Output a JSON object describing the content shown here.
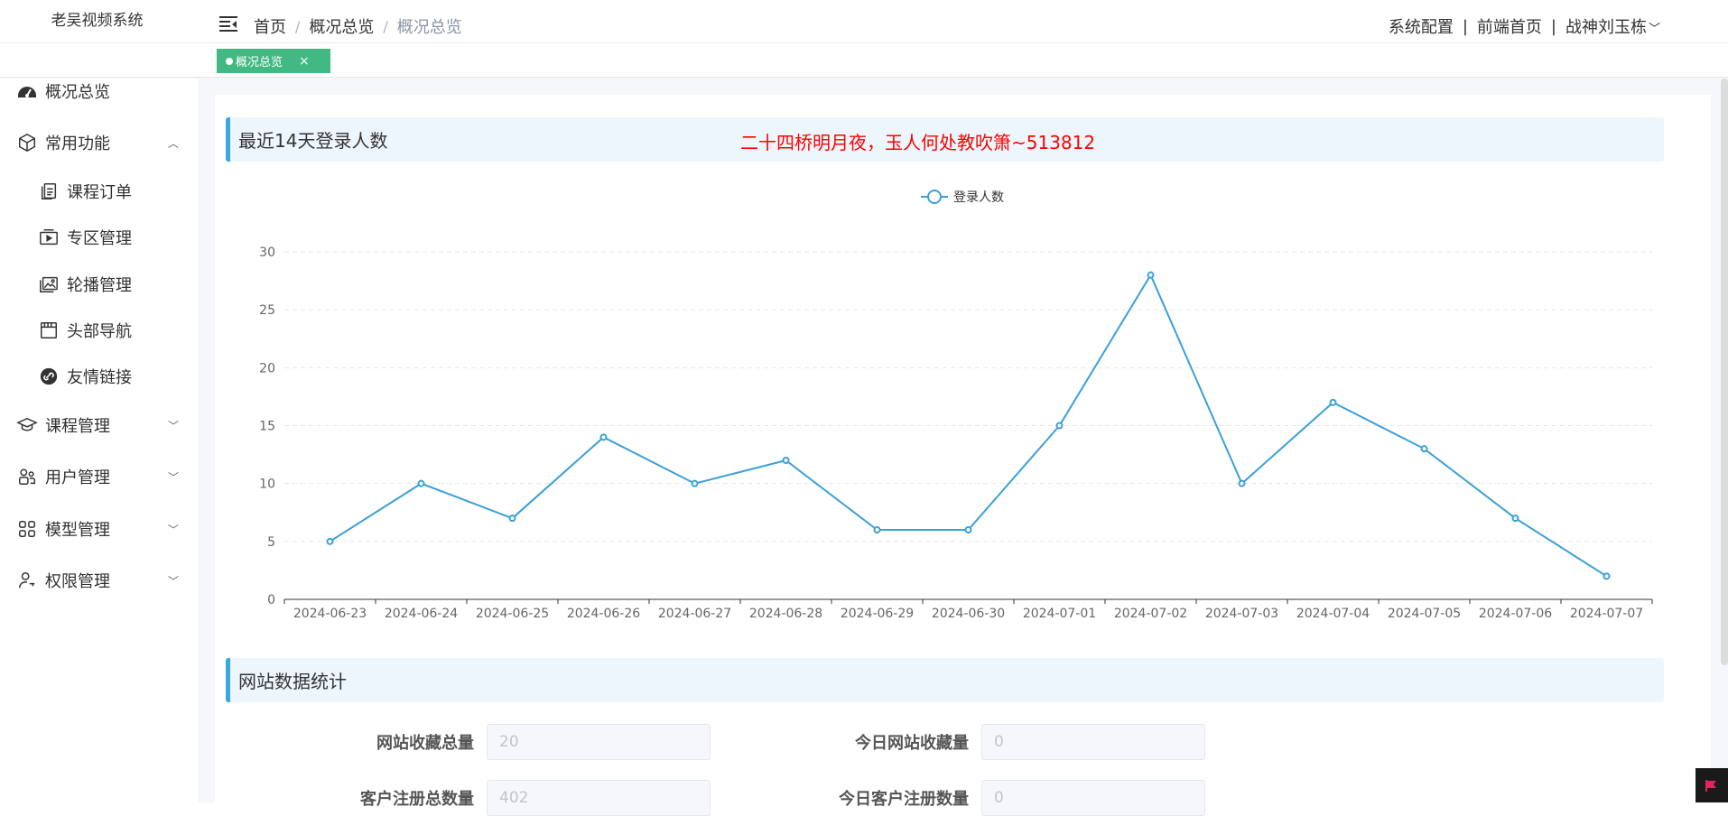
{
  "brand": "老吴视频系统",
  "breadcrumb": {
    "home": "首页",
    "section": "概况总览",
    "current": "概况总览",
    "sep": "/"
  },
  "topnav": {
    "config": "系统配置",
    "sep": "|",
    "frontend": "前端首页",
    "user": "战神刘玉栋"
  },
  "tag": {
    "label": "概况总览",
    "close": "×"
  },
  "sidebar": {
    "items": [
      {
        "label": "概况总览",
        "icon": "dashboard-icon"
      },
      {
        "label": "常用功能",
        "icon": "cube-icon",
        "arrow": "up"
      },
      {
        "label": "课程订单",
        "icon": "document-icon"
      },
      {
        "label": "专区管理",
        "icon": "video-icon"
      },
      {
        "label": "轮播管理",
        "icon": "image-icon"
      },
      {
        "label": "头部导航",
        "icon": "window-icon"
      },
      {
        "label": "友情链接",
        "icon": "link-icon"
      },
      {
        "label": "课程管理",
        "icon": "graduation-cap-icon",
        "arrow": "down"
      },
      {
        "label": "用户管理",
        "icon": "users-icon",
        "arrow": "down"
      },
      {
        "label": "模型管理",
        "icon": "grid-icon",
        "arrow": "down"
      },
      {
        "label": "权限管理",
        "icon": "user-key-icon",
        "arrow": "down"
      }
    ]
  },
  "sections": {
    "login_title": "最近14天登录人数",
    "poem": "二十四桥明月夜，玉人何处教吹箫~513812",
    "stats_title": "网站数据统计"
  },
  "stats": [
    {
      "label": "网站收藏总量",
      "value": "20"
    },
    {
      "label": "今日网站收藏量",
      "value": "0"
    },
    {
      "label": "客户注册总数量",
      "value": "402"
    },
    {
      "label": "今日客户注册数量",
      "value": "0"
    }
  ],
  "colors": {
    "accent": "#3aa6e0",
    "tag": "#42b983",
    "poem": "#ff0000",
    "line": "#3aa0d8"
  },
  "chart_data": {
    "type": "line",
    "categories": [
      "2024-06-23",
      "2024-06-24",
      "2024-06-25",
      "2024-06-26",
      "2024-06-27",
      "2024-06-28",
      "2024-06-29",
      "2024-06-30",
      "2024-07-01",
      "2024-07-02",
      "2024-07-03",
      "2024-07-04",
      "2024-07-05",
      "2024-07-06",
      "2024-07-07"
    ],
    "series": [
      {
        "name": "登录人数",
        "values": [
          5,
          10,
          7,
          14,
          10,
          12,
          6,
          6,
          15,
          28,
          10,
          17,
          13,
          7,
          2
        ]
      }
    ],
    "yticks": [
      0,
      5,
      10,
      15,
      20,
      25,
      30
    ],
    "ylim": [
      0,
      30
    ],
    "grid": true,
    "legend": "top-center"
  }
}
